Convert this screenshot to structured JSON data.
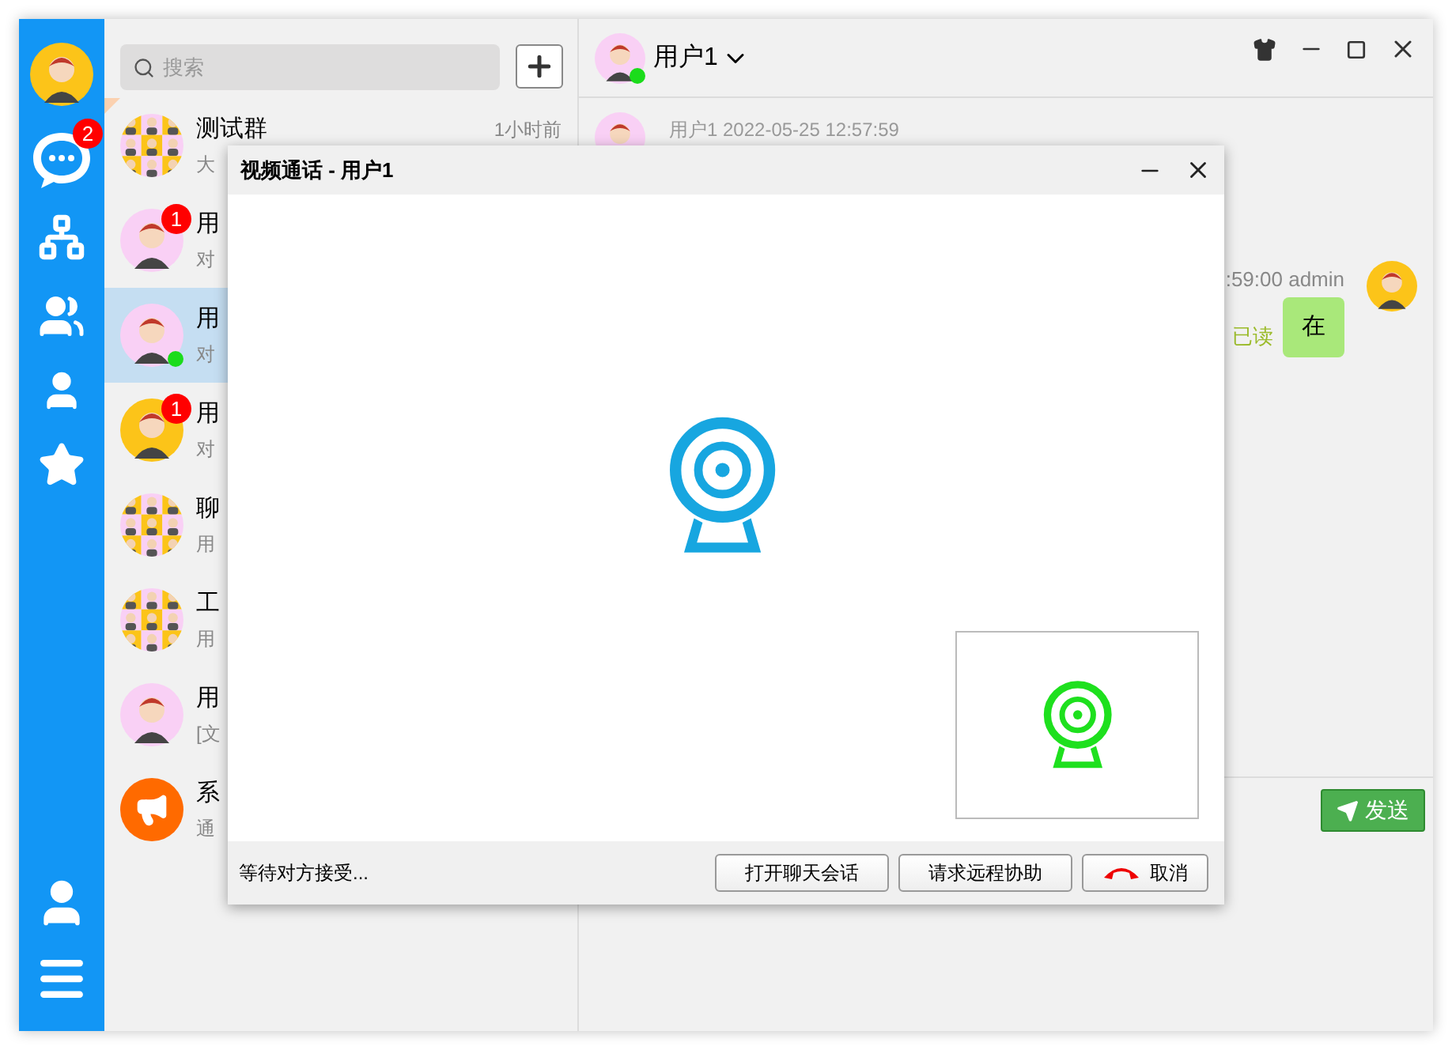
{
  "rail": {
    "chat_badge": "2"
  },
  "search": {
    "placeholder": "搜索"
  },
  "conversations": [
    {
      "kind": "group",
      "name": "测试群",
      "time": "1小时前",
      "preview": "大",
      "pinned": true,
      "selected": false,
      "online": false
    },
    {
      "kind": "person",
      "name": "用",
      "preview": "对",
      "badge": "1",
      "pinned": false,
      "selected": false,
      "online": false
    },
    {
      "kind": "person",
      "name": "用",
      "preview": "对",
      "pinned": false,
      "selected": true,
      "online": true
    },
    {
      "kind": "person",
      "name": "用",
      "preview": "对",
      "badge": "1",
      "pinned": false,
      "selected": false,
      "online": false
    },
    {
      "kind": "group",
      "name": "聊",
      "preview": "用",
      "pinned": false,
      "selected": false,
      "online": false
    },
    {
      "kind": "group",
      "name": "工",
      "preview": "用",
      "pinned": false,
      "selected": false,
      "online": false
    },
    {
      "kind": "person",
      "name": "用",
      "preview": "[文",
      "pinned": false,
      "selected": false,
      "online": false
    },
    {
      "kind": "system",
      "name": "系",
      "preview": "通",
      "pinned": false,
      "selected": false,
      "online": false
    }
  ],
  "chat": {
    "contact": {
      "name": "用户1",
      "online": true
    },
    "messages": [
      {
        "kind": "incoming",
        "meta": "用户1 2022-05-25 12:57:59"
      },
      {
        "kind": "outgoing",
        "meta": ":59:00 admin",
        "text": "在",
        "status": "已读"
      }
    ],
    "send_button": "发送"
  },
  "dialog": {
    "title": "视频通话 - 用户1",
    "status": "等待对方接受...",
    "buttons": [
      {
        "kind": "text",
        "label": "打开聊天会话"
      },
      {
        "kind": "text",
        "label": "请求远程协助"
      },
      {
        "kind": "hangup",
        "label": "取消"
      }
    ]
  }
}
